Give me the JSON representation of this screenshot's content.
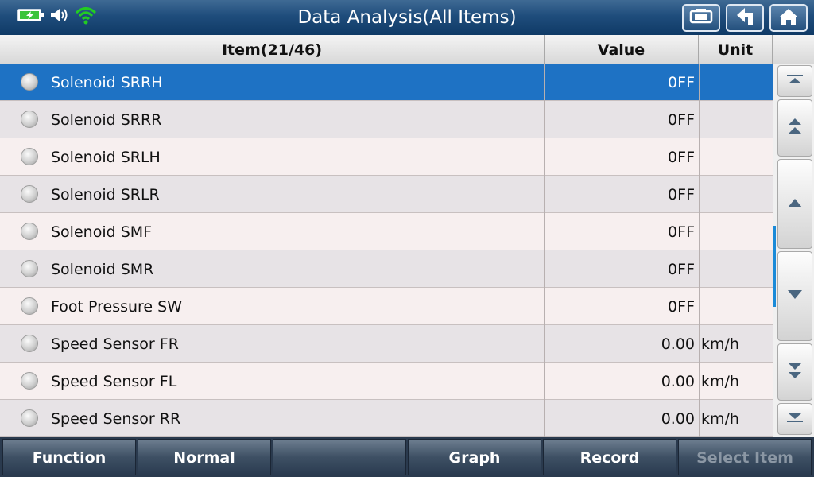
{
  "window": {
    "title": "Data Analysis(All Items)"
  },
  "status_icons": [
    "battery-charging-icon",
    "speaker-icon",
    "wifi-icon"
  ],
  "toolbar_icons": [
    "print-icon",
    "back-up-icon",
    "home-icon"
  ],
  "table": {
    "headers": {
      "item": "Item(21/46)",
      "value": "Value",
      "unit": "Unit"
    },
    "rows": [
      {
        "name": "Solenoid SRRH",
        "value": "0FF",
        "unit": ""
      },
      {
        "name": "Solenoid SRRR",
        "value": "0FF",
        "unit": ""
      },
      {
        "name": "Solenoid SRLH",
        "value": "0FF",
        "unit": ""
      },
      {
        "name": "Solenoid SRLR",
        "value": "0FF",
        "unit": ""
      },
      {
        "name": "Solenoid SMF",
        "value": "0FF",
        "unit": ""
      },
      {
        "name": "Solenoid SMR",
        "value": "0FF",
        "unit": ""
      },
      {
        "name": "Foot Pressure SW",
        "value": "0FF",
        "unit": ""
      },
      {
        "name": "Speed Sensor FR",
        "value": "0.00",
        "unit": "km/h"
      },
      {
        "name": "Speed Sensor FL",
        "value": "0.00",
        "unit": "km/h"
      },
      {
        "name": "Speed Sensor RR",
        "value": "0.00",
        "unit": "km/h"
      }
    ],
    "selected_index": 0
  },
  "scrollbar_icons": [
    "scroll-top-icon",
    "page-up-icon",
    "line-up-icon",
    "line-down-icon",
    "page-down-icon",
    "scroll-bottom-icon"
  ],
  "bottom_bar": {
    "function": "Function",
    "normal": "Normal",
    "empty": "",
    "graph": "Graph",
    "record": "Record",
    "select_item": "Select Item"
  },
  "colors": {
    "selected_row": "#1e72c4",
    "title_bar": "#1f4d7c",
    "battery": "#3cc43c",
    "wifi": "#22cc22"
  }
}
